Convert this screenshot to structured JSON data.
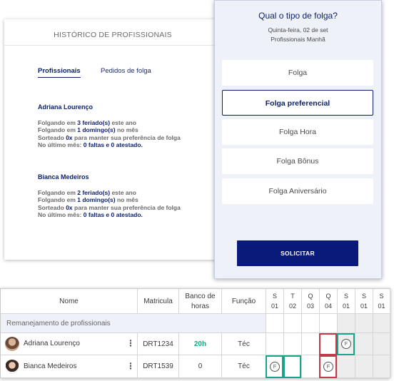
{
  "historico": {
    "title": "HISTÓRICO DE PROFISSIONAIS",
    "tabs": [
      "Profissionais",
      "Pedidos de folga"
    ],
    "professionals": [
      {
        "name": "Adriana Lourenço",
        "l1a": "Folgando em ",
        "l1b": "3 feriado(s)",
        "l1c": " este ano",
        "l2a": "Folgando em ",
        "l2b": "1 domingo(s)",
        "l2c": " no mês",
        "l3a": "Sorteado ",
        "l3b": "0x",
        "l3c": " para manter sua preferência de folga",
        "l4a": "No último mês: ",
        "l4b": "0 faltas e 0 atestado."
      },
      {
        "name": "Bianca Medeiros",
        "l1a": "Folgando em ",
        "l1b": "2 feriado(s)",
        "l1c": " este ano",
        "l2a": "Folgando em ",
        "l2b": "1 domingo(s)",
        "l2c": " no mês",
        "l3a": "Sorteado ",
        "l3b": "0x",
        "l3c": " para manter sua preferência de folga",
        "l4a": "No último mês: ",
        "l4b": "0 faltas e 0 atestado."
      }
    ]
  },
  "modal": {
    "question": "Qual o tipo de folga?",
    "date": "Quinta-feira, 02 de set",
    "shift": "Profissionais Manhã",
    "options": [
      "Folga",
      "Folga preferencial",
      "Folga Hora",
      "Folga Bônus",
      "Folga Aniversário"
    ],
    "selected_option": "Folga preferencial",
    "submit": "SOLICITAR"
  },
  "table": {
    "headers": {
      "nome": "Nome",
      "matricula": "Matricula",
      "banco_l1": "Banco de",
      "banco_l2": "horas",
      "funcao": "Função"
    },
    "days": [
      {
        "d": "S",
        "n": "01"
      },
      {
        "d": "T",
        "n": "02"
      },
      {
        "d": "Q",
        "n": "03"
      },
      {
        "d": "Q",
        "n": "04"
      },
      {
        "d": "S",
        "n": "01"
      },
      {
        "d": "S",
        "n": "01"
      },
      {
        "d": "S",
        "n": "01"
      }
    ],
    "group": "Remanejamento de profissionais",
    "rows": [
      {
        "name": "Adriana Lourenço",
        "matricula": "DRT1234",
        "banco": "20h",
        "funcao": "Téc"
      },
      {
        "name": "Bianca Medeiros",
        "matricula": "DRT1539",
        "banco": "0",
        "funcao": "Téc"
      }
    ],
    "folga_mark": "F",
    "colors": {
      "green": "#18a58a",
      "red": "#c23a4a",
      "accent": "#0a1f6b"
    }
  }
}
